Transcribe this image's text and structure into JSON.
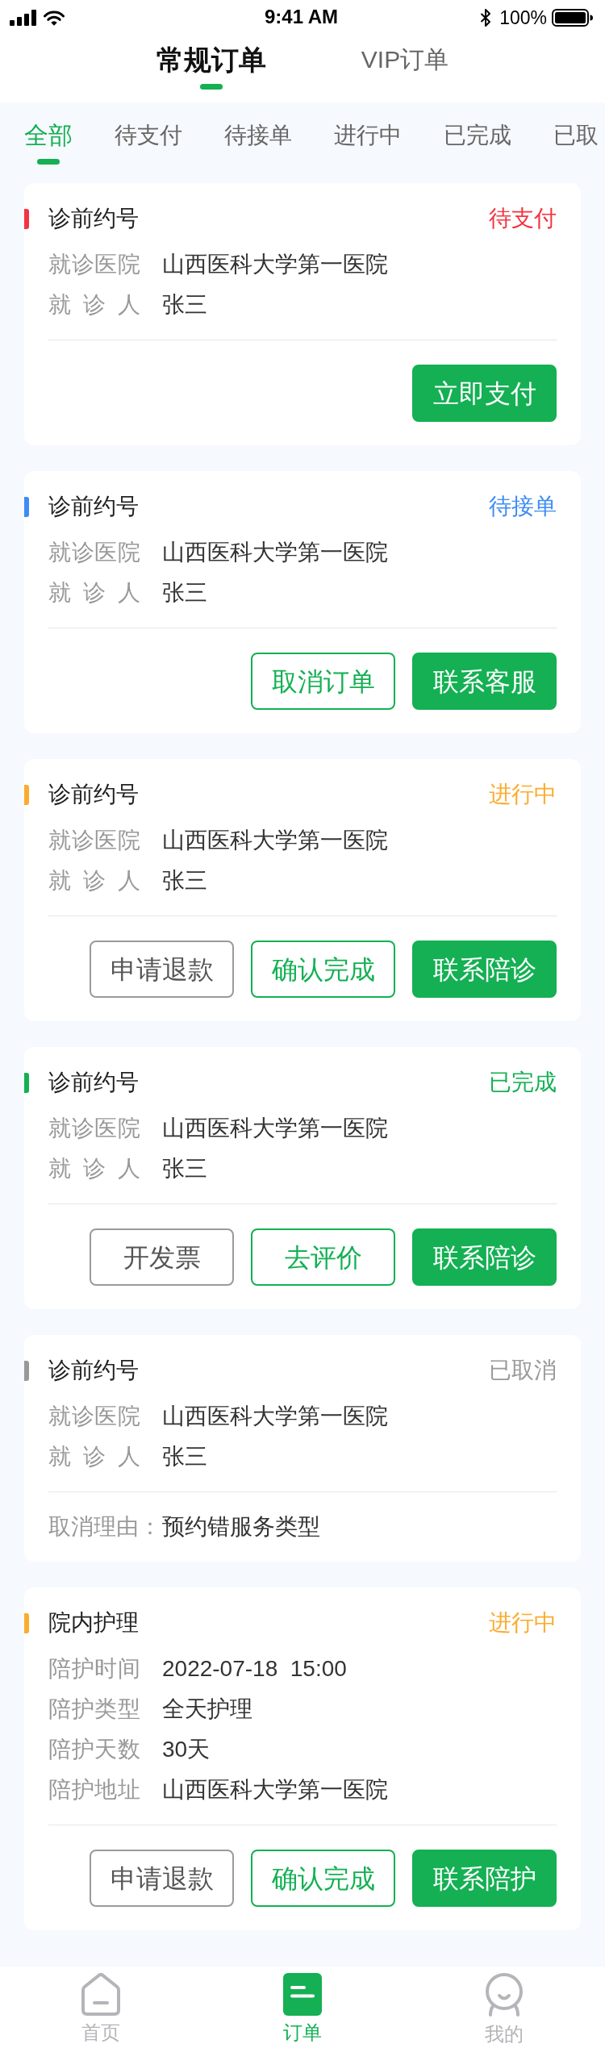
{
  "status_bar": {
    "time": "9:41 AM",
    "battery": "100%"
  },
  "order_type_tabs": [
    {
      "label": "常规订单",
      "selected": true
    },
    {
      "label": "VIP订单",
      "selected": false
    }
  ],
  "status_tabs": [
    {
      "label": "全部",
      "selected": true
    },
    {
      "label": "待支付",
      "selected": false
    },
    {
      "label": "待接单",
      "selected": false
    },
    {
      "label": "进行中",
      "selected": false
    },
    {
      "label": "已完成",
      "selected": false
    },
    {
      "label": "已取",
      "selected": false
    }
  ],
  "orders": [
    {
      "title": "诊前约号",
      "status": "待支付",
      "color": "#f5333f",
      "fields": [
        {
          "label": "就诊医院",
          "value": "山西医科大学第一医院"
        },
        {
          "label": "就 诊 人",
          "value": "张三"
        }
      ],
      "buttons": [
        {
          "label": "立即支付",
          "kind": "filled"
        }
      ]
    },
    {
      "title": "诊前约号",
      "status": "待接单",
      "color": "#3d8cf5",
      "fields": [
        {
          "label": "就诊医院",
          "value": "山西医科大学第一医院"
        },
        {
          "label": "就 诊 人",
          "value": "张三"
        }
      ],
      "buttons": [
        {
          "label": "取消订单",
          "kind": "outline"
        },
        {
          "label": "联系客服",
          "kind": "filled"
        }
      ]
    },
    {
      "title": "诊前约号",
      "status": "进行中",
      "color": "#fbac2f",
      "fields": [
        {
          "label": "就诊医院",
          "value": "山西医科大学第一医院"
        },
        {
          "label": "就 诊 人",
          "value": "张三"
        }
      ],
      "buttons": [
        {
          "label": "申请退款",
          "kind": "plain"
        },
        {
          "label": "确认完成",
          "kind": "outline"
        },
        {
          "label": "联系陪诊",
          "kind": "filled"
        }
      ]
    },
    {
      "title": "诊前约号",
      "status": "已完成",
      "color": "#14b053",
      "fields": [
        {
          "label": "就诊医院",
          "value": "山西医科大学第一医院"
        },
        {
          "label": "就 诊 人",
          "value": "张三"
        }
      ],
      "buttons": [
        {
          "label": "开发票",
          "kind": "plain"
        },
        {
          "label": "去评价",
          "kind": "outline"
        },
        {
          "label": "联系陪诊",
          "kind": "filled"
        }
      ]
    },
    {
      "title": "诊前约号",
      "status": "已取消",
      "color": "#999999",
      "fields": [
        {
          "label": "就诊医院",
          "value": "山西医科大学第一医院"
        },
        {
          "label": "就 诊 人",
          "value": "张三"
        }
      ],
      "cancel_reason": {
        "label": "取消理由：",
        "value": "预约错服务类型"
      }
    },
    {
      "title": "院内护理",
      "status": "进行中",
      "color": "#fbac2f",
      "fields": [
        {
          "label": "陪护时间",
          "value": "2022-07-18  15:00"
        },
        {
          "label": "陪护类型",
          "value": "全天护理"
        },
        {
          "label": "陪护天数",
          "value": "30天"
        },
        {
          "label": "陪护地址",
          "value": "山西医科大学第一医院"
        }
      ],
      "buttons": [
        {
          "label": "申请退款",
          "kind": "plain"
        },
        {
          "label": "确认完成",
          "kind": "outline"
        },
        {
          "label": "联系陪护",
          "kind": "filled"
        }
      ]
    }
  ],
  "tab_bar": [
    {
      "label": "首页",
      "selected": false
    },
    {
      "label": "订单",
      "selected": true
    },
    {
      "label": "我的",
      "selected": false
    }
  ]
}
